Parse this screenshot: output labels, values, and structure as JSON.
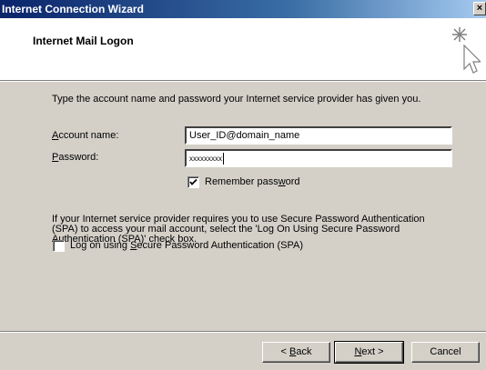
{
  "window": {
    "title": "Internet Connection Wizard",
    "close": "×"
  },
  "header": {
    "title": "Internet Mail Logon"
  },
  "intro": "Type the account name and password your Internet service provider has given you.",
  "account": {
    "label_key": "A",
    "label_rest": "ccount name:",
    "value": "User_ID@domain_name"
  },
  "password": {
    "label_key": "P",
    "label_rest": "assword:",
    "value": "xxxxxxxxx"
  },
  "remember": {
    "label_pre": "Remember pass",
    "label_key": "w",
    "label_post": "ord",
    "checked": true
  },
  "spa_info": "If your Internet service provider requires you to use Secure Password Authentication (SPA) to access your mail account, select the 'Log On Using Secure Password Authentication (SPA)' check box.",
  "spa": {
    "label_pre": "Log on using ",
    "label_key": "S",
    "label_post": "ecure Password Authentication (SPA)",
    "checked": false
  },
  "buttons": {
    "back_pre": "< ",
    "back_key": "B",
    "back_post": "ack",
    "next_key": "N",
    "next_post": "ext >",
    "cancel": "Cancel"
  }
}
